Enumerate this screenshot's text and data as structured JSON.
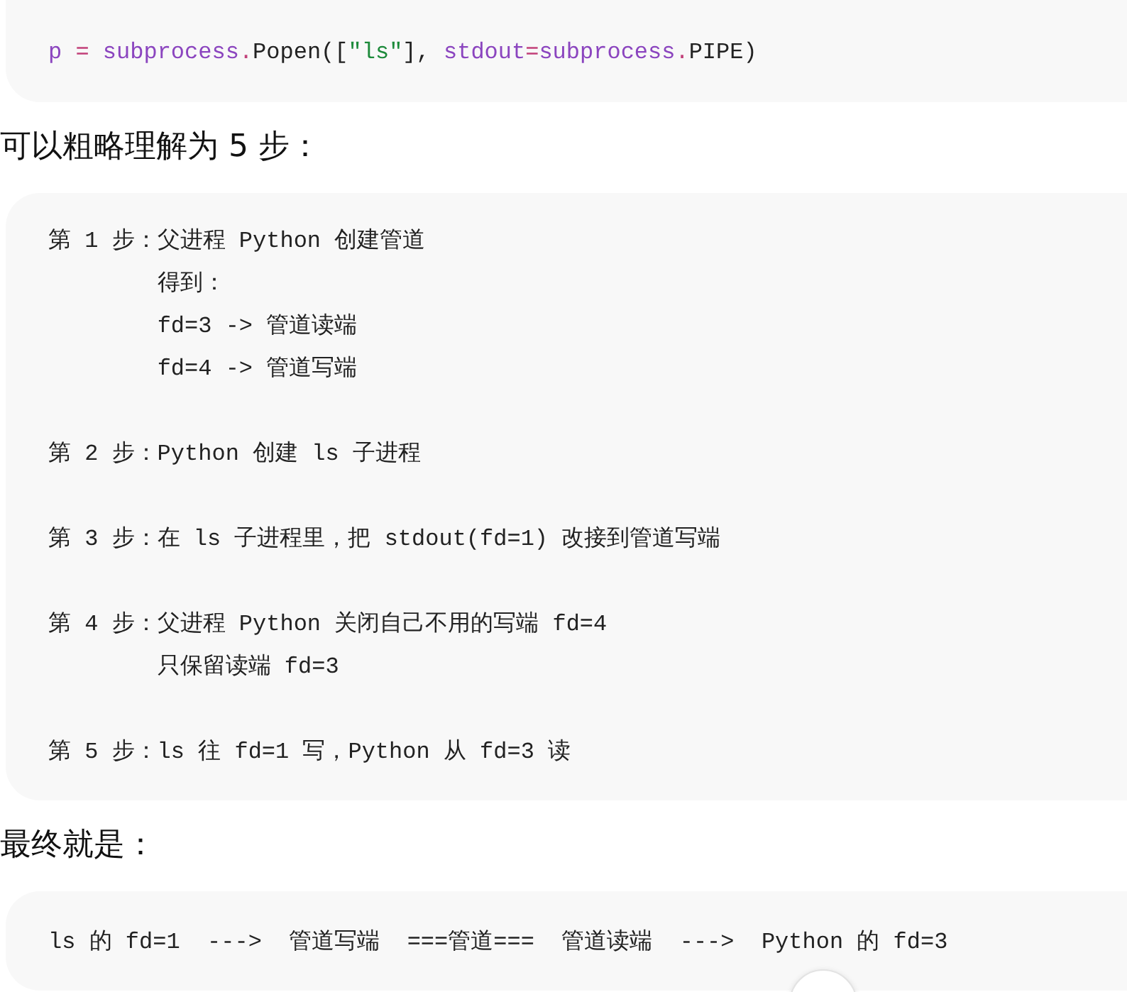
{
  "code_block_1": {
    "tokens": [
      {
        "kind": "name",
        "text": "p"
      },
      {
        "kind": "op",
        "text": " = "
      },
      {
        "kind": "name",
        "text": "subprocess"
      },
      {
        "kind": "op",
        "text": "."
      },
      {
        "kind": "plain",
        "text": "Popen(["
      },
      {
        "kind": "string",
        "text": "\"ls\""
      },
      {
        "kind": "plain",
        "text": "], "
      },
      {
        "kind": "name",
        "text": "stdout"
      },
      {
        "kind": "op",
        "text": "="
      },
      {
        "kind": "name",
        "text": "subprocess"
      },
      {
        "kind": "op",
        "text": "."
      },
      {
        "kind": "plain",
        "text": "PIPE)"
      }
    ]
  },
  "heading_1": "可以粗略理解为 5 步：",
  "code_block_2": {
    "paragraphs": [
      {
        "lines": [
          "第 1 步：父进程 Python 创建管道",
          "        得到：",
          "        fd=3 -> 管道读端",
          "        fd=4 -> 管道写端"
        ]
      },
      {
        "lines": [
          "第 2 步：Python 创建 ls 子进程"
        ]
      },
      {
        "lines": [
          "第 3 步：在 ls 子进程里，把 stdout(fd=1) 改接到管道写端"
        ]
      },
      {
        "lines": [
          "第 4 步：父进程 Python 关闭自己不用的写端 fd=4",
          "        只保留读端 fd=3"
        ]
      },
      {
        "lines": [
          "第 5 步：ls 往 fd=1 写，Python 从 fd=3 读"
        ]
      }
    ]
  },
  "heading_2": "最终就是：",
  "code_block_3": {
    "lines": [
      "ls 的 fd=1  --->  管道写端  ===管道===  管道读端  --->  Python 的 fd=3"
    ]
  }
}
